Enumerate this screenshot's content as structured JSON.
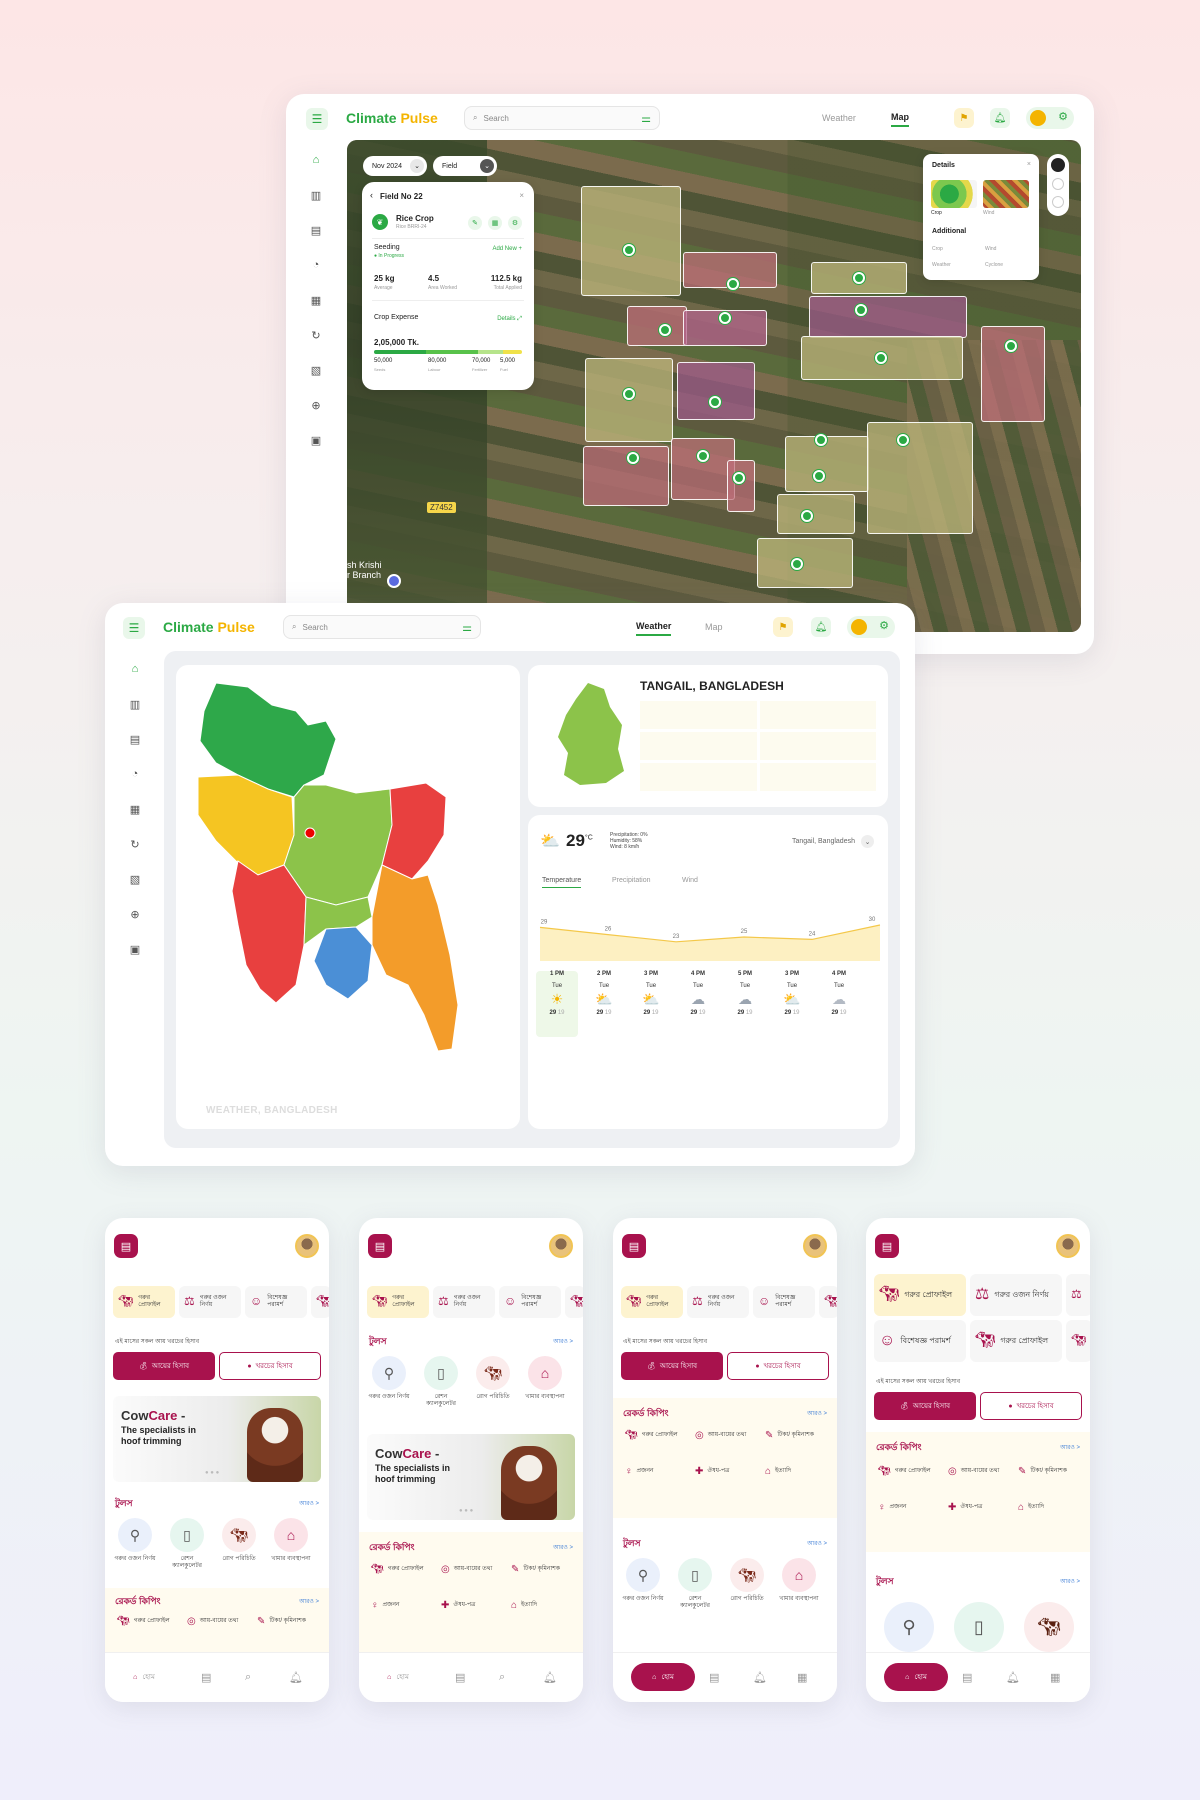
{
  "brand": {
    "name_a": "Climate",
    "name_b": "Pulse"
  },
  "search": {
    "placeholder": "Search"
  },
  "tabs": {
    "weather": "Weather",
    "map": "Map"
  },
  "map_screen": {
    "date_select": "Nov 2024",
    "field_select": "Field",
    "field_card": {
      "title": "Field No 22",
      "crop": "Rice Crop",
      "variety": "Rice BRRI-24",
      "stage": "Seeding",
      "stage_status": "In Progress",
      "add_new": "Add New +",
      "stats": [
        {
          "value": "25 kg",
          "label": "Average"
        },
        {
          "value": "4.5",
          "label": "Area Worked"
        },
        {
          "value": "112.5 kg",
          "label": "Total Applied"
        }
      ],
      "expense_label": "Crop Expense",
      "details_link": "Details",
      "expense_total": "2,05,000 Tk.",
      "expense_breakdown": [
        {
          "value": "50,000",
          "label": "Seeds"
        },
        {
          "value": "80,000",
          "label": "Labour"
        },
        {
          "value": "70,000",
          "label": "Fertilizer"
        },
        {
          "value": "5,000",
          "label": "Fuel"
        }
      ],
      "expense_share": [
        0.35,
        0.35,
        0.17,
        0.13
      ]
    },
    "details_card": {
      "title": "Details",
      "thumbs": [
        "Crop",
        "Wind"
      ],
      "additional": "Additional",
      "rows": [
        [
          "Crop",
          "Wind"
        ],
        [
          "Weather",
          "Cyclone"
        ]
      ]
    },
    "road_label": "Z7452",
    "place_label": "sh Krishi\nr Branch"
  },
  "weather_screen": {
    "map_caption": "WEATHER, BANGLADESH",
    "region_title": "TANGAIL, BANGLADESH",
    "current": {
      "temp": "29",
      "unit": "°C",
      "precip": "Precipitation: 0%",
      "humidity": "Humidity: 58%",
      "wind": "Wind: 8 km/h",
      "location": "Tangail, Bangladesh"
    },
    "subtabs": [
      "Temperature",
      "Precipitation",
      "Wind"
    ],
    "chart_data": {
      "type": "area",
      "x": [
        0,
        1,
        2,
        3,
        4,
        5
      ],
      "values": [
        29,
        26,
        23,
        25,
        24,
        30
      ],
      "labels": [
        "29",
        "26",
        "23",
        "25",
        "24",
        "30"
      ],
      "ylim": [
        15,
        35
      ]
    },
    "forecast": [
      {
        "time": "1 PM",
        "day": "Tue",
        "hi": "29",
        "lo": "19",
        "icon": "sun"
      },
      {
        "time": "2 PM",
        "day": "Tue",
        "hi": "29",
        "lo": "19",
        "icon": "partly"
      },
      {
        "time": "3 PM",
        "day": "Tue",
        "hi": "29",
        "lo": "19",
        "icon": "partly-rain"
      },
      {
        "time": "4 PM",
        "day": "Tue",
        "hi": "29",
        "lo": "19",
        "icon": "rain"
      },
      {
        "time": "5 PM",
        "day": "Tue",
        "hi": "29",
        "lo": "19",
        "icon": "rain"
      },
      {
        "time": "3 PM",
        "day": "Tue",
        "hi": "29",
        "lo": "19",
        "icon": "partly-rain"
      },
      {
        "time": "4 PM",
        "day": "Tue",
        "hi": "29",
        "lo": "19",
        "icon": "cloud"
      }
    ]
  },
  "mobile": {
    "chips": [
      "গরুর প্রোফাইল",
      "গরুর ওজন নির্ণয়",
      "বিশেষজ্ঞ পরামর্শ"
    ],
    "month_summary": "এই মাসের সকল আয় খরচের হিসাব",
    "income_btn": "আয়ের হিসাব",
    "expense_btn": "খরচের হিসাব",
    "tools_title": "টুলস",
    "records_title": "রেকর্ড কিপিং",
    "more": "আরও >",
    "banner": {
      "brand_a": "Cow",
      "brand_b": "Care",
      "dash": " -",
      "line1": "The specialists in",
      "line2": "hoof trimming"
    },
    "tools": [
      "গরুর ওজন নির্ণয়",
      "রেশন ক্যালকুলেটর",
      "রোগ পরিচিতি",
      "খামার ব্যবস্থাপনা"
    ],
    "records": [
      "গরুর প্রোফাইল",
      "আয়-ব্যয়ের তথ্য",
      "টিকা/ কৃমিনাশক",
      "প্রজনন",
      "ঔষধ-পত্র",
      "ইত্যাদি"
    ],
    "nav_home": "হোম"
  },
  "colors": {
    "brand_green": "#2ba944",
    "brand_yellow": "#f4b400",
    "maroon": "#a8124d"
  }
}
